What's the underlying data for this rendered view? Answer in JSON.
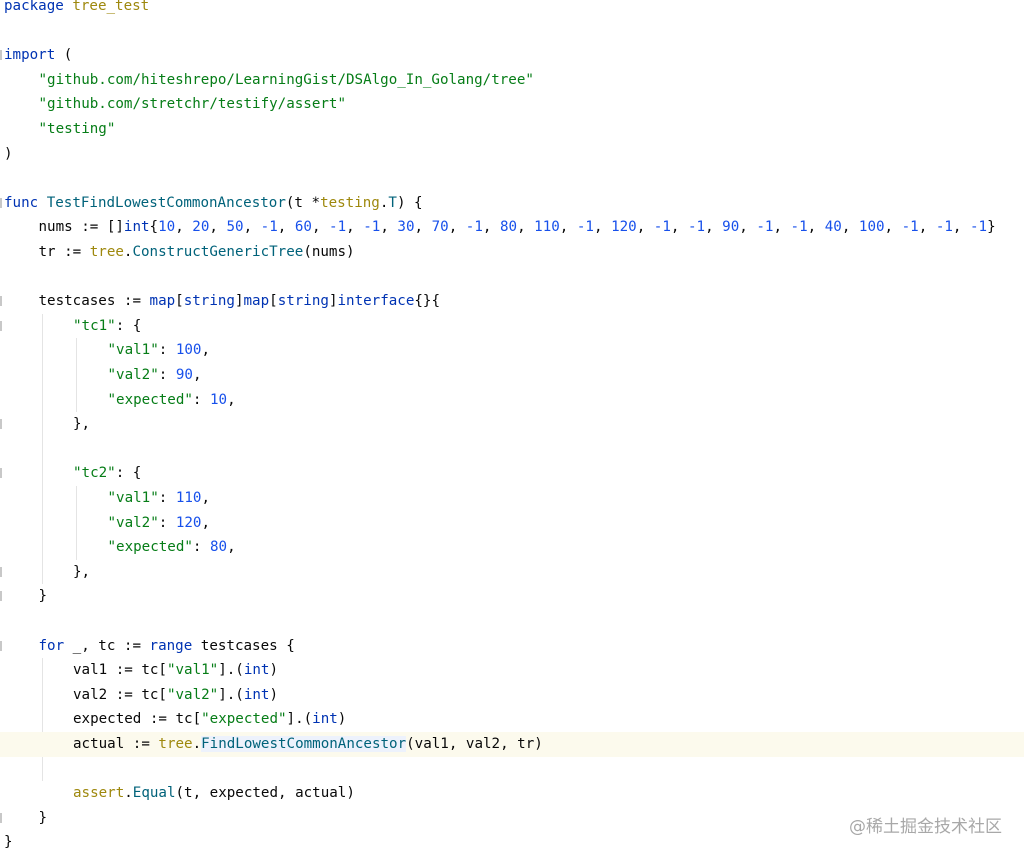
{
  "watermark": "@稀土掘金技术社区",
  "code_lines": [
    {
      "indent": 0,
      "current": false,
      "tokens": [
        [
          "k",
          "package"
        ],
        [
          "t",
          " "
        ],
        [
          "p",
          "tree_test"
        ]
      ]
    },
    {
      "indent": 0,
      "current": false,
      "tokens": []
    },
    {
      "indent": 0,
      "current": false,
      "tokens": [
        [
          "k",
          "import"
        ],
        [
          "t",
          " ("
        ]
      ]
    },
    {
      "indent": 1,
      "current": false,
      "tokens": [
        [
          "s",
          "\"github.com/hiteshrepo/LearningGist/DSAlgo_In_Golang/tree\""
        ]
      ]
    },
    {
      "indent": 1,
      "current": false,
      "tokens": [
        [
          "s",
          "\"github.com/stretchr/testify/assert\""
        ]
      ]
    },
    {
      "indent": 1,
      "current": false,
      "tokens": [
        [
          "s",
          "\"testing\""
        ]
      ]
    },
    {
      "indent": 0,
      "current": false,
      "tokens": [
        [
          "t",
          ")"
        ]
      ]
    },
    {
      "indent": 0,
      "current": false,
      "tokens": []
    },
    {
      "indent": 0,
      "current": false,
      "tokens": [
        [
          "k",
          "func"
        ],
        [
          "t",
          " "
        ],
        [
          "f",
          "TestFindLowestCommonAncestor"
        ],
        [
          "t",
          "(t *"
        ],
        [
          "p",
          "testing"
        ],
        [
          "t",
          "."
        ],
        [
          "f",
          "T"
        ],
        [
          "t",
          ") {"
        ]
      ]
    },
    {
      "indent": 1,
      "current": false,
      "tokens": [
        [
          "t",
          "nums := []"
        ],
        [
          "k",
          "int"
        ],
        [
          "t",
          "{"
        ],
        [
          "n",
          "10"
        ],
        [
          "t",
          ", "
        ],
        [
          "n",
          "20"
        ],
        [
          "t",
          ", "
        ],
        [
          "n",
          "50"
        ],
        [
          "t",
          ", "
        ],
        [
          "n",
          "-1"
        ],
        [
          "t",
          ", "
        ],
        [
          "n",
          "60"
        ],
        [
          "t",
          ", "
        ],
        [
          "n",
          "-1"
        ],
        [
          "t",
          ", "
        ],
        [
          "n",
          "-1"
        ],
        [
          "t",
          ", "
        ],
        [
          "n",
          "30"
        ],
        [
          "t",
          ", "
        ],
        [
          "n",
          "70"
        ],
        [
          "t",
          ", "
        ],
        [
          "n",
          "-1"
        ],
        [
          "t",
          ", "
        ],
        [
          "n",
          "80"
        ],
        [
          "t",
          ", "
        ],
        [
          "n",
          "110"
        ],
        [
          "t",
          ", "
        ],
        [
          "n",
          "-1"
        ],
        [
          "t",
          ", "
        ],
        [
          "n",
          "120"
        ],
        [
          "t",
          ", "
        ],
        [
          "n",
          "-1"
        ],
        [
          "t",
          ", "
        ],
        [
          "n",
          "-1"
        ],
        [
          "t",
          ", "
        ],
        [
          "n",
          "90"
        ],
        [
          "t",
          ", "
        ],
        [
          "n",
          "-1"
        ],
        [
          "t",
          ", "
        ],
        [
          "n",
          "-1"
        ],
        [
          "t",
          ", "
        ],
        [
          "n",
          "40"
        ],
        [
          "t",
          ", "
        ],
        [
          "n",
          "100"
        ],
        [
          "t",
          ", "
        ],
        [
          "n",
          "-1"
        ],
        [
          "t",
          ", "
        ],
        [
          "n",
          "-1"
        ],
        [
          "t",
          ", "
        ],
        [
          "n",
          "-1"
        ],
        [
          "t",
          "}"
        ]
      ]
    },
    {
      "indent": 1,
      "current": false,
      "tokens": [
        [
          "t",
          "tr := "
        ],
        [
          "p",
          "tree"
        ],
        [
          "t",
          "."
        ],
        [
          "f",
          "ConstructGenericTree"
        ],
        [
          "t",
          "(nums)"
        ]
      ]
    },
    {
      "indent": 0,
      "current": false,
      "tokens": []
    },
    {
      "indent": 1,
      "current": false,
      "tokens": [
        [
          "t",
          "testcases := "
        ],
        [
          "k",
          "map"
        ],
        [
          "t",
          "["
        ],
        [
          "k",
          "string"
        ],
        [
          "t",
          "]"
        ],
        [
          "k",
          "map"
        ],
        [
          "t",
          "["
        ],
        [
          "k",
          "string"
        ],
        [
          "t",
          "]"
        ],
        [
          "k",
          "interface"
        ],
        [
          "t",
          "{}{"
        ]
      ]
    },
    {
      "indent": 2,
      "current": false,
      "tokens": [
        [
          "s",
          "\"tc1\""
        ],
        [
          "t",
          ": {"
        ]
      ]
    },
    {
      "indent": 3,
      "current": false,
      "tokens": [
        [
          "s",
          "\"val1\""
        ],
        [
          "t",
          ": "
        ],
        [
          "n",
          "100"
        ],
        [
          "t",
          ","
        ]
      ]
    },
    {
      "indent": 3,
      "current": false,
      "tokens": [
        [
          "s",
          "\"val2\""
        ],
        [
          "t",
          ": "
        ],
        [
          "n",
          "90"
        ],
        [
          "t",
          ","
        ]
      ]
    },
    {
      "indent": 3,
      "current": false,
      "tokens": [
        [
          "s",
          "\"expected\""
        ],
        [
          "t",
          ": "
        ],
        [
          "n",
          "10"
        ],
        [
          "t",
          ","
        ]
      ]
    },
    {
      "indent": 2,
      "current": false,
      "tokens": [
        [
          "t",
          "},"
        ]
      ]
    },
    {
      "indent": 0,
      "current": false,
      "tokens": []
    },
    {
      "indent": 2,
      "current": false,
      "tokens": [
        [
          "s",
          "\"tc2\""
        ],
        [
          "t",
          ": {"
        ]
      ]
    },
    {
      "indent": 3,
      "current": false,
      "tokens": [
        [
          "s",
          "\"val1\""
        ],
        [
          "t",
          ": "
        ],
        [
          "n",
          "110"
        ],
        [
          "t",
          ","
        ]
      ]
    },
    {
      "indent": 3,
      "current": false,
      "tokens": [
        [
          "s",
          "\"val2\""
        ],
        [
          "t",
          ": "
        ],
        [
          "n",
          "120"
        ],
        [
          "t",
          ","
        ]
      ]
    },
    {
      "indent": 3,
      "current": false,
      "tokens": [
        [
          "s",
          "\"expected\""
        ],
        [
          "t",
          ": "
        ],
        [
          "n",
          "80"
        ],
        [
          "t",
          ","
        ]
      ]
    },
    {
      "indent": 2,
      "current": false,
      "tokens": [
        [
          "t",
          "},"
        ]
      ]
    },
    {
      "indent": 1,
      "current": false,
      "tokens": [
        [
          "t",
          "}"
        ]
      ]
    },
    {
      "indent": 0,
      "current": false,
      "tokens": []
    },
    {
      "indent": 1,
      "current": false,
      "tokens": [
        [
          "k",
          "for"
        ],
        [
          "t",
          " _, tc := "
        ],
        [
          "k",
          "range"
        ],
        [
          "t",
          " testcases {"
        ]
      ]
    },
    {
      "indent": 2,
      "current": false,
      "tokens": [
        [
          "t",
          "val1 := tc["
        ],
        [
          "s",
          "\"val1\""
        ],
        [
          "t",
          "].("
        ],
        [
          "k",
          "int"
        ],
        [
          "t",
          ")"
        ]
      ]
    },
    {
      "indent": 2,
      "current": false,
      "tokens": [
        [
          "t",
          "val2 := tc["
        ],
        [
          "s",
          "\"val2\""
        ],
        [
          "t",
          "].("
        ],
        [
          "k",
          "int"
        ],
        [
          "t",
          ")"
        ]
      ]
    },
    {
      "indent": 2,
      "current": false,
      "tokens": [
        [
          "t",
          "expected := tc["
        ],
        [
          "s",
          "\"expected\""
        ],
        [
          "t",
          "].("
        ],
        [
          "k",
          "int"
        ],
        [
          "t",
          ")"
        ]
      ]
    },
    {
      "indent": 2,
      "current": true,
      "tokens": [
        [
          "t",
          "actual := "
        ],
        [
          "p",
          "tree"
        ],
        [
          "t",
          "."
        ],
        [
          "fh",
          "FindLowestCommonAncestor"
        ],
        [
          "t",
          "(val1, val2, tr)"
        ]
      ]
    },
    {
      "indent": 0,
      "current": false,
      "tokens": []
    },
    {
      "indent": 2,
      "current": false,
      "tokens": [
        [
          "p",
          "assert"
        ],
        [
          "t",
          "."
        ],
        [
          "f",
          "Equal"
        ],
        [
          "t",
          "(t, expected, actual)"
        ]
      ]
    },
    {
      "indent": 1,
      "current": false,
      "tokens": [
        [
          "t",
          "}"
        ]
      ]
    },
    {
      "indent": 0,
      "current": false,
      "tokens": [
        [
          "t",
          "}"
        ]
      ]
    }
  ]
}
